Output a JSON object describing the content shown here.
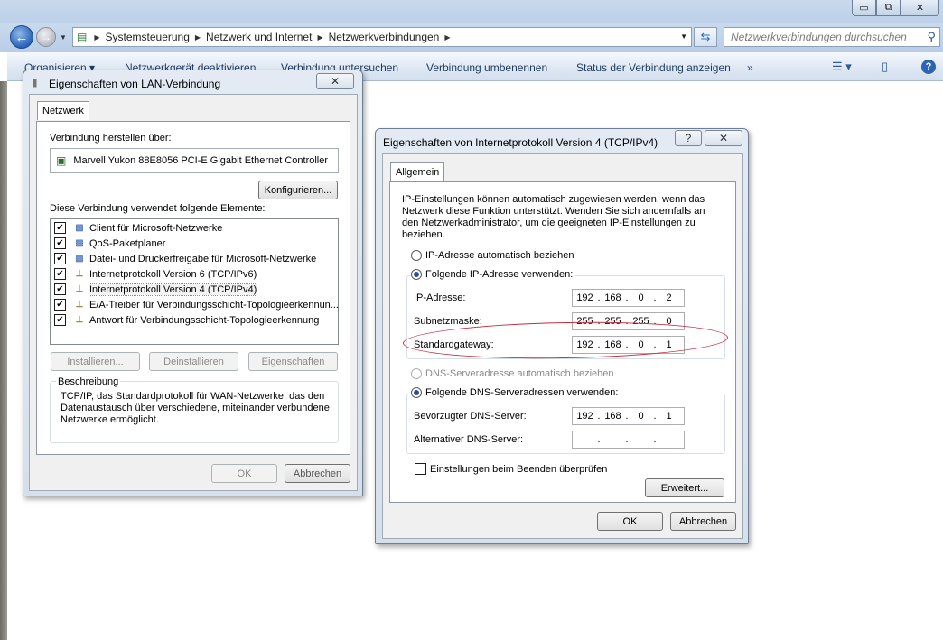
{
  "explorer": {
    "breadcrumb": [
      "Systemsteuerung",
      "Netzwerk und Internet",
      "Netzwerkverbindungen"
    ],
    "search_placeholder": "Netzwerkverbindungen durchsuchen",
    "toolbar": [
      "Organisieren ▾",
      "Netzwerkgerät deaktivieren",
      "Verbindung untersuchen",
      "Verbindung umbenennen",
      "Status der Verbindung anzeigen",
      "»"
    ]
  },
  "lan_dialog": {
    "title": "Eigenschaften von LAN-Verbindung",
    "tab": "Netzwerk",
    "connect_via_label": "Verbindung herstellen über:",
    "adapter": "Marvell Yukon 88E8056 PCI-E Gigabit Ethernet Controller",
    "configure_button": "Konfigurieren...",
    "items_label": "Diese Verbindung verwendet folgende Elemente:",
    "items": [
      {
        "label": "Client für Microsoft-Netzwerke",
        "checked": true,
        "icon": "network-client-icon"
      },
      {
        "label": "QoS-Paketplaner",
        "checked": true,
        "icon": "network-service-icon"
      },
      {
        "label": "Datei- und Druckerfreigabe für Microsoft-Netzwerke",
        "checked": true,
        "icon": "network-service-icon"
      },
      {
        "label": "Internetprotokoll Version 6 (TCP/IPv6)",
        "checked": true,
        "icon": "protocol-icon"
      },
      {
        "label": "Internetprotokoll Version 4 (TCP/IPv4)",
        "checked": true,
        "icon": "protocol-icon"
      },
      {
        "label": "E/A-Treiber für Verbindungsschicht-Topologieerkennun...",
        "checked": true,
        "icon": "protocol-icon"
      },
      {
        "label": "Antwort für Verbindungsschicht-Topologieerkennung",
        "checked": true,
        "icon": "protocol-icon"
      }
    ],
    "install_button": "Installieren...",
    "uninstall_button": "Deinstallieren",
    "properties_button": "Eigenschaften",
    "description_title": "Beschreibung",
    "description_text": "TCP/IP, das Standardprotokoll für WAN-Netzwerke, das den Datenaustausch über verschiedene, miteinander verbundene Netzwerke ermöglicht.",
    "ok_button": "OK",
    "cancel_button": "Abbrechen"
  },
  "ipv4_dialog": {
    "title": "Eigenschaften von Internetprotokoll Version 4 (TCP/IPv4)",
    "help_button": "?",
    "tab": "Allgemein",
    "intro": "IP-Einstellungen können automatisch zugewiesen werden, wenn das Netzwerk diese Funktion unterstützt. Wenden Sie sich andernfalls an den Netzwerkadministrator, um die geeigneten IP-Einstellungen zu beziehen.",
    "auto_ip": "IP-Adresse automatisch beziehen",
    "manual_ip": "Folgende IP-Adresse verwenden:",
    "ip_label": "IP-Adresse:",
    "ip": [
      "192",
      "168",
      "0",
      "2"
    ],
    "subnet_label": "Subnetzmaske:",
    "subnet": [
      "255",
      "255",
      "255",
      "0"
    ],
    "gateway_label": "Standardgateway:",
    "gateway": [
      "192",
      "168",
      "0",
      "1"
    ],
    "auto_dns": "DNS-Serveradresse automatisch beziehen",
    "manual_dns": "Folgende DNS-Serveradressen verwenden:",
    "pref_dns_label": "Bevorzugter DNS-Server:",
    "pref_dns": [
      "192",
      "168",
      "0",
      "1"
    ],
    "alt_dns_label": "Alternativer DNS-Server:",
    "alt_dns": [
      "",
      "",
      "",
      ""
    ],
    "validate_label": "Einstellungen beim Beenden überprüfen",
    "advanced_button": "Erweitert...",
    "ok_button": "OK",
    "cancel_button": "Abbrechen"
  }
}
